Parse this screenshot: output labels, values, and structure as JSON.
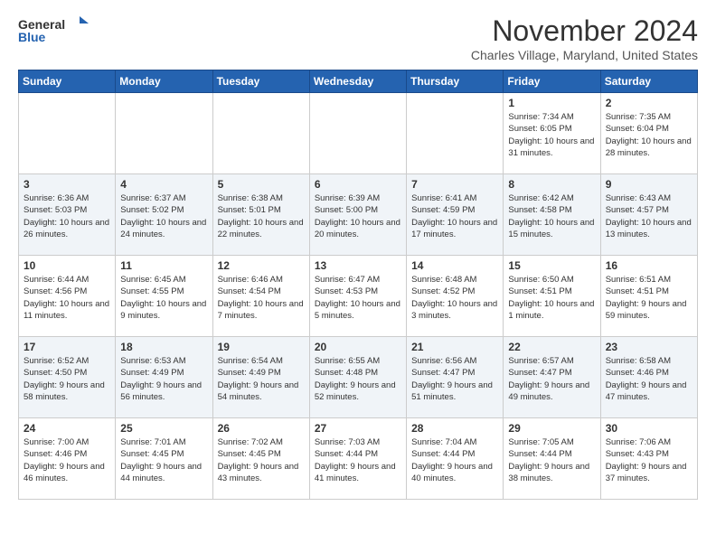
{
  "header": {
    "logo_general": "General",
    "logo_blue": "Blue",
    "month_title": "November 2024",
    "location": "Charles Village, Maryland, United States"
  },
  "weekdays": [
    "Sunday",
    "Monday",
    "Tuesday",
    "Wednesday",
    "Thursday",
    "Friday",
    "Saturday"
  ],
  "rows": [
    {
      "cells": [
        {
          "empty": true
        },
        {
          "empty": true
        },
        {
          "empty": true
        },
        {
          "empty": true
        },
        {
          "empty": true
        },
        {
          "day": "1",
          "sunrise": "Sunrise: 7:34 AM",
          "sunset": "Sunset: 6:05 PM",
          "daylight": "Daylight: 10 hours and 31 minutes."
        },
        {
          "day": "2",
          "sunrise": "Sunrise: 7:35 AM",
          "sunset": "Sunset: 6:04 PM",
          "daylight": "Daylight: 10 hours and 28 minutes."
        }
      ]
    },
    {
      "cells": [
        {
          "day": "3",
          "sunrise": "Sunrise: 6:36 AM",
          "sunset": "Sunset: 5:03 PM",
          "daylight": "Daylight: 10 hours and 26 minutes."
        },
        {
          "day": "4",
          "sunrise": "Sunrise: 6:37 AM",
          "sunset": "Sunset: 5:02 PM",
          "daylight": "Daylight: 10 hours and 24 minutes."
        },
        {
          "day": "5",
          "sunrise": "Sunrise: 6:38 AM",
          "sunset": "Sunset: 5:01 PM",
          "daylight": "Daylight: 10 hours and 22 minutes."
        },
        {
          "day": "6",
          "sunrise": "Sunrise: 6:39 AM",
          "sunset": "Sunset: 5:00 PM",
          "daylight": "Daylight: 10 hours and 20 minutes."
        },
        {
          "day": "7",
          "sunrise": "Sunrise: 6:41 AM",
          "sunset": "Sunset: 4:59 PM",
          "daylight": "Daylight: 10 hours and 17 minutes."
        },
        {
          "day": "8",
          "sunrise": "Sunrise: 6:42 AM",
          "sunset": "Sunset: 4:58 PM",
          "daylight": "Daylight: 10 hours and 15 minutes."
        },
        {
          "day": "9",
          "sunrise": "Sunrise: 6:43 AM",
          "sunset": "Sunset: 4:57 PM",
          "daylight": "Daylight: 10 hours and 13 minutes."
        }
      ]
    },
    {
      "cells": [
        {
          "day": "10",
          "sunrise": "Sunrise: 6:44 AM",
          "sunset": "Sunset: 4:56 PM",
          "daylight": "Daylight: 10 hours and 11 minutes."
        },
        {
          "day": "11",
          "sunrise": "Sunrise: 6:45 AM",
          "sunset": "Sunset: 4:55 PM",
          "daylight": "Daylight: 10 hours and 9 minutes."
        },
        {
          "day": "12",
          "sunrise": "Sunrise: 6:46 AM",
          "sunset": "Sunset: 4:54 PM",
          "daylight": "Daylight: 10 hours and 7 minutes."
        },
        {
          "day": "13",
          "sunrise": "Sunrise: 6:47 AM",
          "sunset": "Sunset: 4:53 PM",
          "daylight": "Daylight: 10 hours and 5 minutes."
        },
        {
          "day": "14",
          "sunrise": "Sunrise: 6:48 AM",
          "sunset": "Sunset: 4:52 PM",
          "daylight": "Daylight: 10 hours and 3 minutes."
        },
        {
          "day": "15",
          "sunrise": "Sunrise: 6:50 AM",
          "sunset": "Sunset: 4:51 PM",
          "daylight": "Daylight: 10 hours and 1 minute."
        },
        {
          "day": "16",
          "sunrise": "Sunrise: 6:51 AM",
          "sunset": "Sunset: 4:51 PM",
          "daylight": "Daylight: 9 hours and 59 minutes."
        }
      ]
    },
    {
      "cells": [
        {
          "day": "17",
          "sunrise": "Sunrise: 6:52 AM",
          "sunset": "Sunset: 4:50 PM",
          "daylight": "Daylight: 9 hours and 58 minutes."
        },
        {
          "day": "18",
          "sunrise": "Sunrise: 6:53 AM",
          "sunset": "Sunset: 4:49 PM",
          "daylight": "Daylight: 9 hours and 56 minutes."
        },
        {
          "day": "19",
          "sunrise": "Sunrise: 6:54 AM",
          "sunset": "Sunset: 4:49 PM",
          "daylight": "Daylight: 9 hours and 54 minutes."
        },
        {
          "day": "20",
          "sunrise": "Sunrise: 6:55 AM",
          "sunset": "Sunset: 4:48 PM",
          "daylight": "Daylight: 9 hours and 52 minutes."
        },
        {
          "day": "21",
          "sunrise": "Sunrise: 6:56 AM",
          "sunset": "Sunset: 4:47 PM",
          "daylight": "Daylight: 9 hours and 51 minutes."
        },
        {
          "day": "22",
          "sunrise": "Sunrise: 6:57 AM",
          "sunset": "Sunset: 4:47 PM",
          "daylight": "Daylight: 9 hours and 49 minutes."
        },
        {
          "day": "23",
          "sunrise": "Sunrise: 6:58 AM",
          "sunset": "Sunset: 4:46 PM",
          "daylight": "Daylight: 9 hours and 47 minutes."
        }
      ]
    },
    {
      "cells": [
        {
          "day": "24",
          "sunrise": "Sunrise: 7:00 AM",
          "sunset": "Sunset: 4:46 PM",
          "daylight": "Daylight: 9 hours and 46 minutes."
        },
        {
          "day": "25",
          "sunrise": "Sunrise: 7:01 AM",
          "sunset": "Sunset: 4:45 PM",
          "daylight": "Daylight: 9 hours and 44 minutes."
        },
        {
          "day": "26",
          "sunrise": "Sunrise: 7:02 AM",
          "sunset": "Sunset: 4:45 PM",
          "daylight": "Daylight: 9 hours and 43 minutes."
        },
        {
          "day": "27",
          "sunrise": "Sunrise: 7:03 AM",
          "sunset": "Sunset: 4:44 PM",
          "daylight": "Daylight: 9 hours and 41 minutes."
        },
        {
          "day": "28",
          "sunrise": "Sunrise: 7:04 AM",
          "sunset": "Sunset: 4:44 PM",
          "daylight": "Daylight: 9 hours and 40 minutes."
        },
        {
          "day": "29",
          "sunrise": "Sunrise: 7:05 AM",
          "sunset": "Sunset: 4:44 PM",
          "daylight": "Daylight: 9 hours and 38 minutes."
        },
        {
          "day": "30",
          "sunrise": "Sunrise: 7:06 AM",
          "sunset": "Sunset: 4:43 PM",
          "daylight": "Daylight: 9 hours and 37 minutes."
        }
      ]
    }
  ]
}
